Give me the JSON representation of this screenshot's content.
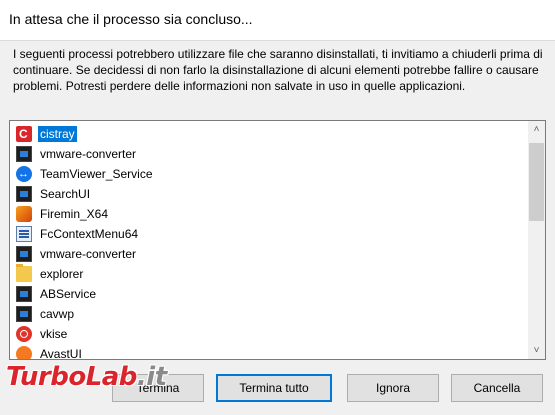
{
  "dialog": {
    "title": "In attesa che il processo sia concluso...",
    "message": "I seguenti processi potrebbero utilizzare file che saranno disinstallati, ti invitiamo a chiuderli prima di continuare. Se decidessi di non farlo la disinstallazione di alcuni elementi potrebbe fallire o causare problemi. Potresti perdere delle informazioni non salvate in uso in quelle applicazioni."
  },
  "processes": [
    {
      "name": "cistray",
      "icon": "cistray-icon",
      "selected": true
    },
    {
      "name": "vmware-converter",
      "icon": "vmware-converter-icon"
    },
    {
      "name": "TeamViewer_Service",
      "icon": "teamviewer-icon"
    },
    {
      "name": "SearchUI",
      "icon": "searchui-icon"
    },
    {
      "name": "Firemin_X64",
      "icon": "firemin-icon"
    },
    {
      "name": "FcContextMenu64",
      "icon": "fccontextmenu-icon"
    },
    {
      "name": "vmware-converter",
      "icon": "vmware-converter-icon"
    },
    {
      "name": "explorer",
      "icon": "explorer-folder-icon"
    },
    {
      "name": "ABService",
      "icon": "abservice-icon"
    },
    {
      "name": "cavwp",
      "icon": "cavwp-icon"
    },
    {
      "name": "vkise",
      "icon": "vkise-icon"
    },
    {
      "name": "AvastUI",
      "icon": "avast-icon"
    }
  ],
  "scrollbar": {
    "up": "˄",
    "down": "˅"
  },
  "buttons": {
    "terminate": "Termina",
    "terminate_all": "Termina tutto",
    "ignore": "Ignora",
    "cancel": "Cancella"
  },
  "watermark": {
    "part1": "TurboLab",
    "part2": ".it"
  },
  "colors": {
    "selection": "#0078d7",
    "watermark": "#d9252b"
  }
}
